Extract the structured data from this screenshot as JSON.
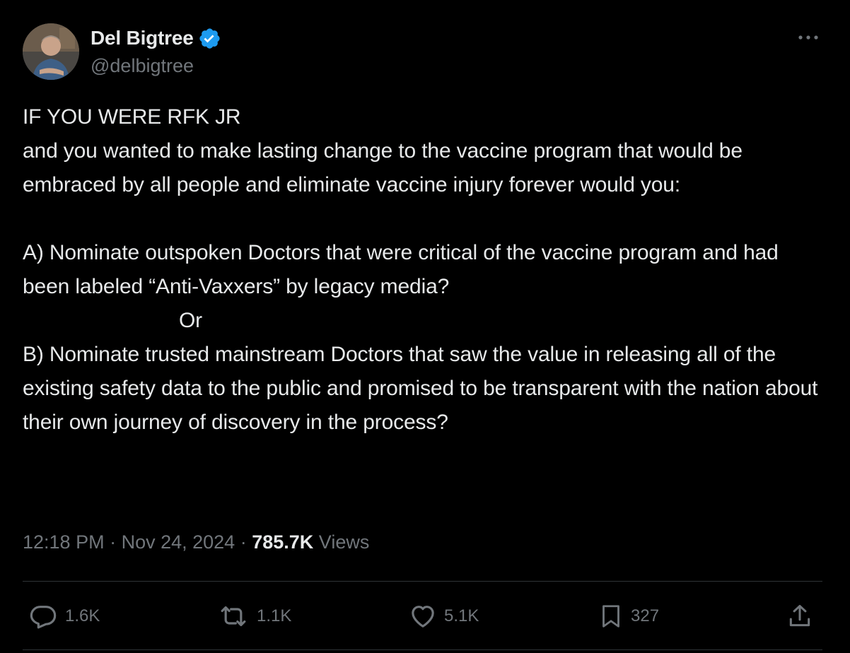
{
  "author": {
    "name": "Del Bigtree",
    "handle": "@delbigtree",
    "verified_color": "#1d9bf0"
  },
  "tweet": {
    "text": "IF YOU WERE RFK JR\nand you wanted to make lasting change to the vaccine program that would be embraced by all people and eliminate vaccine injury forever would you:\n\nA) Nominate outspoken Doctors that were critical of the vaccine program and had been labeled “Anti-Vaxxers” by legacy media?\n                           Or\nB) Nominate trusted mainstream Doctors that saw the value in releasing all of the existing safety data to the public and promised to be transparent with the nation about their own journey of discovery in the process?",
    "time": "12:18 PM",
    "separator": " · ",
    "date": "Nov 24, 2024",
    "views_count": "785.7K",
    "views_label": "Views"
  },
  "actions": {
    "replies": "1.6K",
    "reposts": "1.1K",
    "likes": "5.1K",
    "bookmarks": "327"
  },
  "icons": {
    "more": "more-horizontal-icon",
    "reply": "reply-icon",
    "repost": "repost-icon",
    "like": "heart-icon",
    "bookmark": "bookmark-icon",
    "share": "share-icon"
  },
  "colors": {
    "background": "#000000",
    "text": "#e7e9ea",
    "muted": "#71767b",
    "divider": "#2f3336"
  }
}
